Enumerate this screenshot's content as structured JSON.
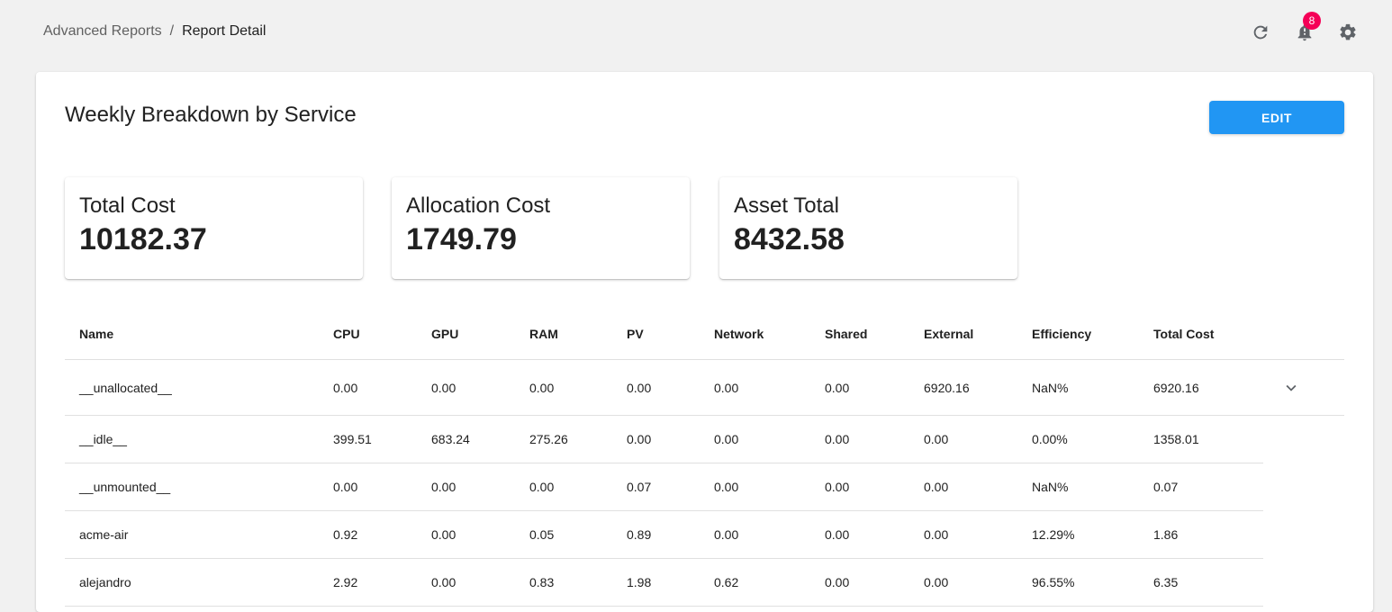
{
  "breadcrumb": {
    "parent": "Advanced Reports",
    "separator": "/",
    "current": "Report Detail"
  },
  "header": {
    "notification_count": "8",
    "icons": [
      "refresh-icon",
      "bell-icon",
      "gear-icon"
    ],
    "badge_color": "#f50057"
  },
  "report": {
    "title": "Weekly Breakdown by Service",
    "edit_label": "EDIT",
    "accent_color": "#2196f3"
  },
  "summary": [
    {
      "label": "Total Cost",
      "value": "10182.37"
    },
    {
      "label": "Allocation Cost",
      "value": "1749.79"
    },
    {
      "label": "Asset Total",
      "value": "8432.58"
    }
  ],
  "table": {
    "columns": [
      "Name",
      "CPU",
      "GPU",
      "RAM",
      "PV",
      "Network",
      "Shared",
      "External",
      "Efficiency",
      "Total Cost"
    ],
    "rows": [
      [
        "__unallocated__",
        "0.00",
        "0.00",
        "0.00",
        "0.00",
        "0.00",
        "0.00",
        "6920.16",
        "NaN%",
        "6920.16"
      ],
      [
        "__idle__",
        "399.51",
        "683.24",
        "275.26",
        "0.00",
        "0.00",
        "0.00",
        "0.00",
        "0.00%",
        "1358.01"
      ],
      [
        "__unmounted__",
        "0.00",
        "0.00",
        "0.00",
        "0.07",
        "0.00",
        "0.00",
        "0.00",
        "NaN%",
        "0.07"
      ],
      [
        "acme-air",
        "0.92",
        "0.00",
        "0.05",
        "0.89",
        "0.00",
        "0.00",
        "0.00",
        "12.29%",
        "1.86"
      ],
      [
        "alejandro",
        "2.92",
        "0.00",
        "0.83",
        "1.98",
        "0.62",
        "0.00",
        "0.00",
        "96.55%",
        "6.35"
      ]
    ]
  }
}
